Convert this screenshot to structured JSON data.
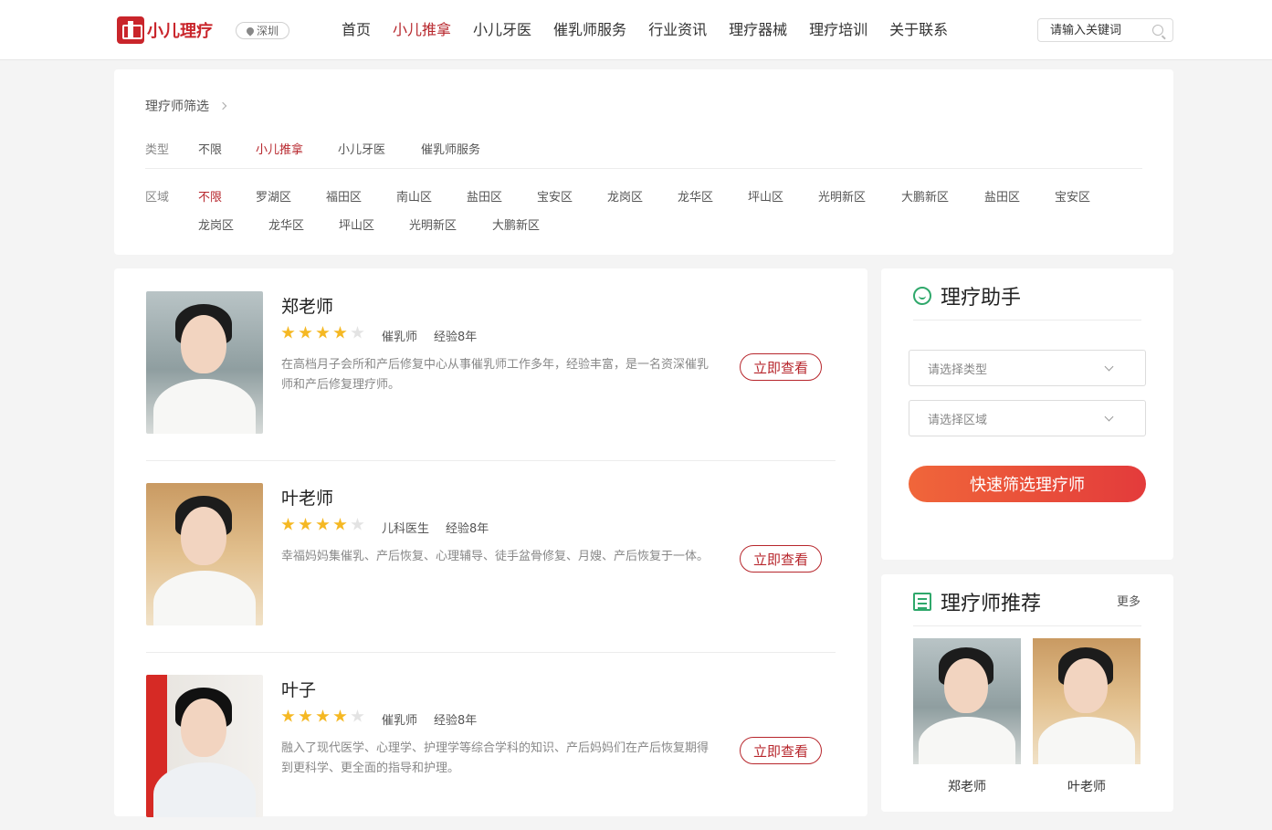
{
  "header": {
    "logo_text": "小儿理疗",
    "city": "深圳",
    "nav": [
      {
        "label": "首页",
        "active": false
      },
      {
        "label": "小儿推拿",
        "active": true
      },
      {
        "label": "小儿牙医",
        "active": false
      },
      {
        "label": "催乳师服务",
        "active": false
      },
      {
        "label": "行业资讯",
        "active": false
      },
      {
        "label": "理疗器械",
        "active": false
      },
      {
        "label": "理疗培训",
        "active": false
      },
      {
        "label": "关于联系",
        "active": false
      }
    ],
    "search_placeholder": "请输入关键词"
  },
  "filter": {
    "breadcrumb": "理疗师筛选",
    "type_label": "类型",
    "types": [
      "不限",
      "小儿推拿",
      "小儿牙医",
      "催乳师服务"
    ],
    "type_active": "小儿推拿",
    "area_label": "区域",
    "areas": [
      "不限",
      "罗湖区",
      "福田区",
      "南山区",
      "盐田区",
      "宝安区",
      "龙岗区",
      "龙华区",
      "坪山区",
      "光明新区",
      "大鹏新区",
      "盐田区",
      "宝安区",
      "龙岗区",
      "龙华区",
      "坪山区",
      "光明新区",
      "大鹏新区"
    ],
    "area_active": "不限"
  },
  "therapists": [
    {
      "name": "郑老师",
      "rating": 4,
      "role": "催乳师",
      "experience": "经验8年",
      "desc": "在高档月子会所和产后修复中心从事催乳师工作多年，经验丰富，是一名资深催乳师和产后修复理疗师。",
      "button": "立即查看"
    },
    {
      "name": "叶老师",
      "rating": 4,
      "role": "儿科医生",
      "experience": "经验8年",
      "desc": "幸福妈妈集催乳、产后恢复、心理辅导、徒手盆骨修复、月嫂、产后恢复于一体。",
      "button": "立即查看"
    },
    {
      "name": "叶子",
      "rating": 4,
      "role": "催乳师",
      "experience": "经验8年",
      "desc": "融入了现代医学、心理学、护理学等综合学科的知识、产后妈妈们在产后恢复期得到更科学、更全面的指导和护理。",
      "button": "立即查看"
    }
  ],
  "assistant": {
    "title": "理疗助手",
    "select_type": "请选择类型",
    "select_area": "请选择区域",
    "button": "快速筛选理疗师"
  },
  "recommend": {
    "title": "理疗师推荐",
    "more": "更多",
    "items": [
      {
        "name": "郑老师"
      },
      {
        "name": "叶老师"
      }
    ]
  },
  "colors": {
    "accent": "#b7262c",
    "star": "#f5b823",
    "icon_green": "#2fa86b",
    "button_gradient_start": "#f0663a",
    "button_gradient_end": "#e33b3b"
  }
}
